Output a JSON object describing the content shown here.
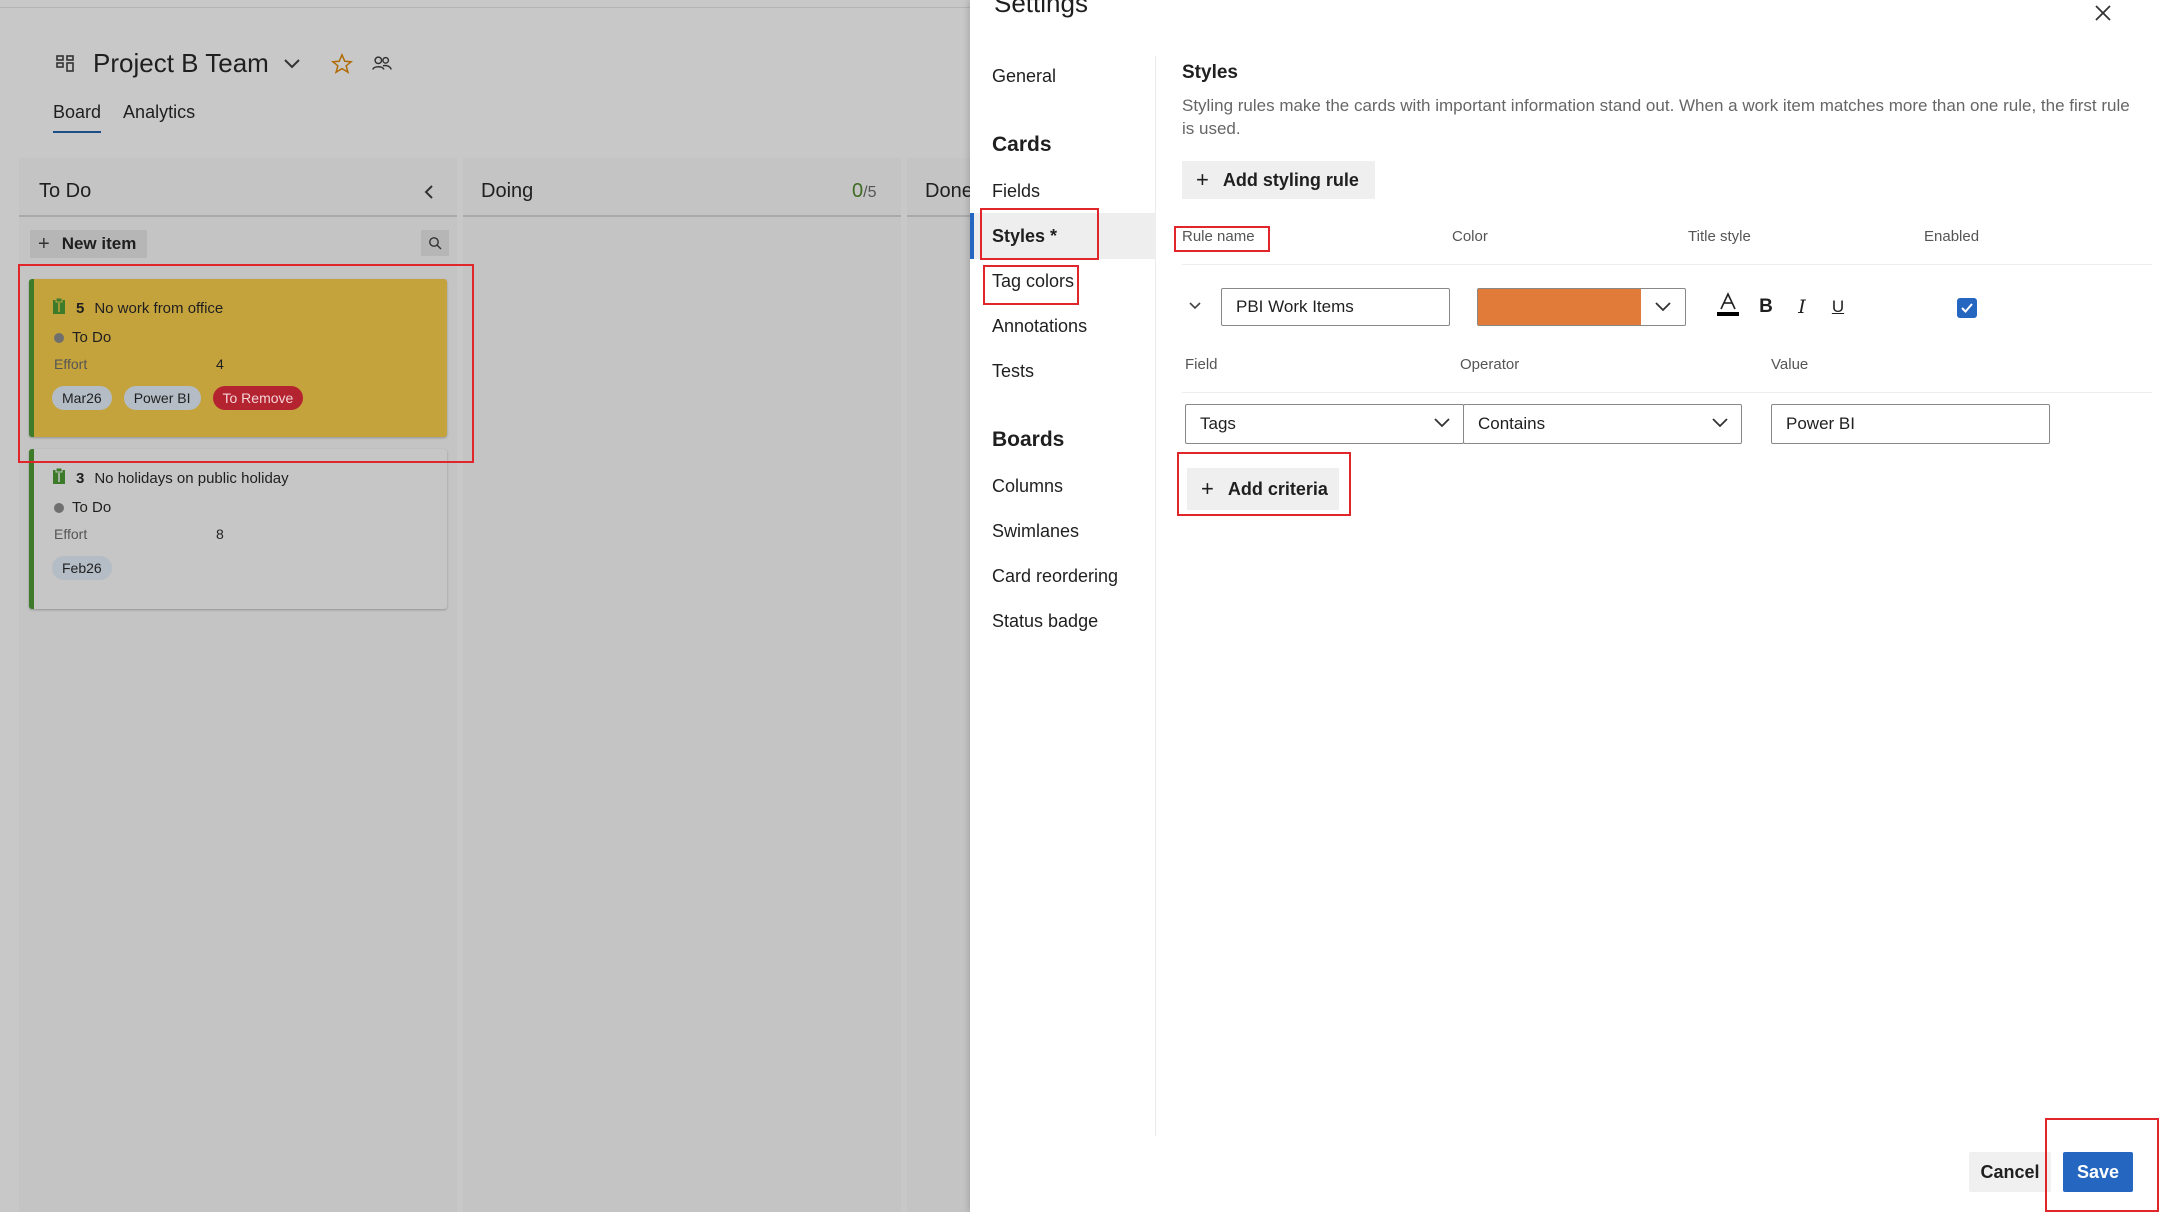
{
  "board": {
    "team_name": "Project B Team",
    "tabs": [
      {
        "label": "Board",
        "active": true
      },
      {
        "label": "Analytics",
        "active": false
      }
    ],
    "columns": [
      {
        "title": "To Do",
        "count": "",
        "limit": ""
      },
      {
        "title": "Doing",
        "count": "0",
        "limit": "/5"
      },
      {
        "title": "Done",
        "count": "",
        "limit": ""
      }
    ],
    "new_item_label": "New item",
    "cards": [
      {
        "id": "5",
        "title": "No work from office",
        "state": "To Do",
        "field_label": "Effort",
        "field_value": "4",
        "tags": [
          "Mar26",
          "Power BI",
          "To Remove"
        ]
      },
      {
        "id": "3",
        "title": "No holidays on public holiday",
        "state": "To Do",
        "field_label": "Effort",
        "field_value": "8",
        "tags": [
          "Feb26"
        ]
      }
    ]
  },
  "settings": {
    "title": "Settings",
    "nav": {
      "general": "General",
      "cards_group": "Cards",
      "fields": "Fields",
      "styles": "Styles *",
      "tag_colors": "Tag colors",
      "annotations": "Annotations",
      "tests": "Tests",
      "boards_group": "Boards",
      "columns": "Columns",
      "swimlanes": "Swimlanes",
      "card_reordering": "Card reordering",
      "status_badge": "Status badge"
    },
    "styles": {
      "heading": "Styles",
      "description": "Styling rules make the cards with important information stand out. When a work item matches more than one rule, the first rule is used.",
      "add_rule_label": "Add styling rule",
      "headers": {
        "rule_name": "Rule name",
        "color": "Color",
        "title_style": "Title style",
        "enabled": "Enabled"
      },
      "rule": {
        "name": "PBI Work Items",
        "color": "#e07b39",
        "enabled": true
      },
      "criteria_headers": {
        "field": "Field",
        "operator": "Operator",
        "value": "Value"
      },
      "criteria": {
        "field": "Tags",
        "operator": "Contains",
        "value": "Power BI"
      },
      "add_criteria_label": "Add criteria"
    },
    "cancel_label": "Cancel",
    "save_label": "Save"
  },
  "colors": {
    "accent": "#2566c1",
    "annotation": "#e0262b",
    "card_highlight": "#c4a33d",
    "tag_red": "#b42330"
  }
}
